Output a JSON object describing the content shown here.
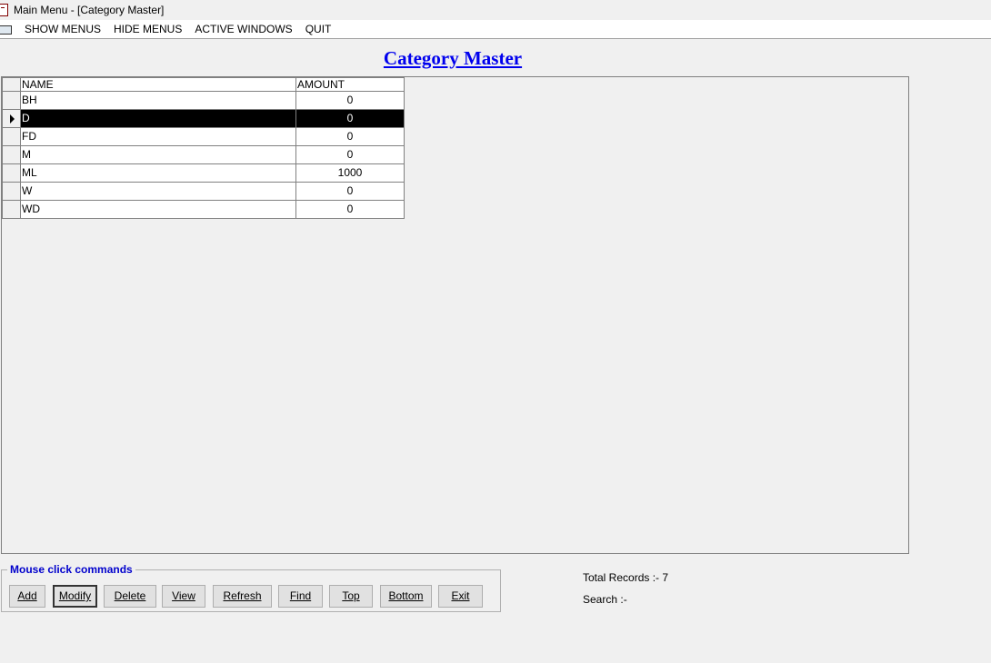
{
  "window": {
    "title": "Main Menu - [Category Master]"
  },
  "menubar": {
    "items": [
      "SHOW MENUS",
      "HIDE MENUS",
      "ACTIVE WINDOWS",
      "QUIT"
    ]
  },
  "page": {
    "title": "Category Master"
  },
  "grid": {
    "columns": [
      "NAME",
      "AMOUNT"
    ],
    "selected_row": 1,
    "rows": [
      {
        "name": "BH",
        "amount": "0"
      },
      {
        "name": "D",
        "amount": "0"
      },
      {
        "name": "FD",
        "amount": "0"
      },
      {
        "name": "M",
        "amount": "0"
      },
      {
        "name": "ML",
        "amount": "1000"
      },
      {
        "name": "W",
        "amount": "0"
      },
      {
        "name": "WD",
        "amount": "0"
      }
    ]
  },
  "commands": {
    "legend": "Mouse click commands",
    "buttons": [
      "Add",
      "Modify",
      "Delete",
      "View",
      "Refresh",
      "Find",
      "Top",
      "Bottom",
      "Exit"
    ]
  },
  "status": {
    "total_records": "Total Records :- 7",
    "search": "Search :-"
  },
  "icons": {
    "app": "app-window-icon",
    "menu": "menu-toolbar-icon",
    "row_pointer": "row-pointer-icon"
  },
  "colors": {
    "title": "#0000ee",
    "legend": "#0000cc",
    "selected_row_bg": "#000000"
  }
}
